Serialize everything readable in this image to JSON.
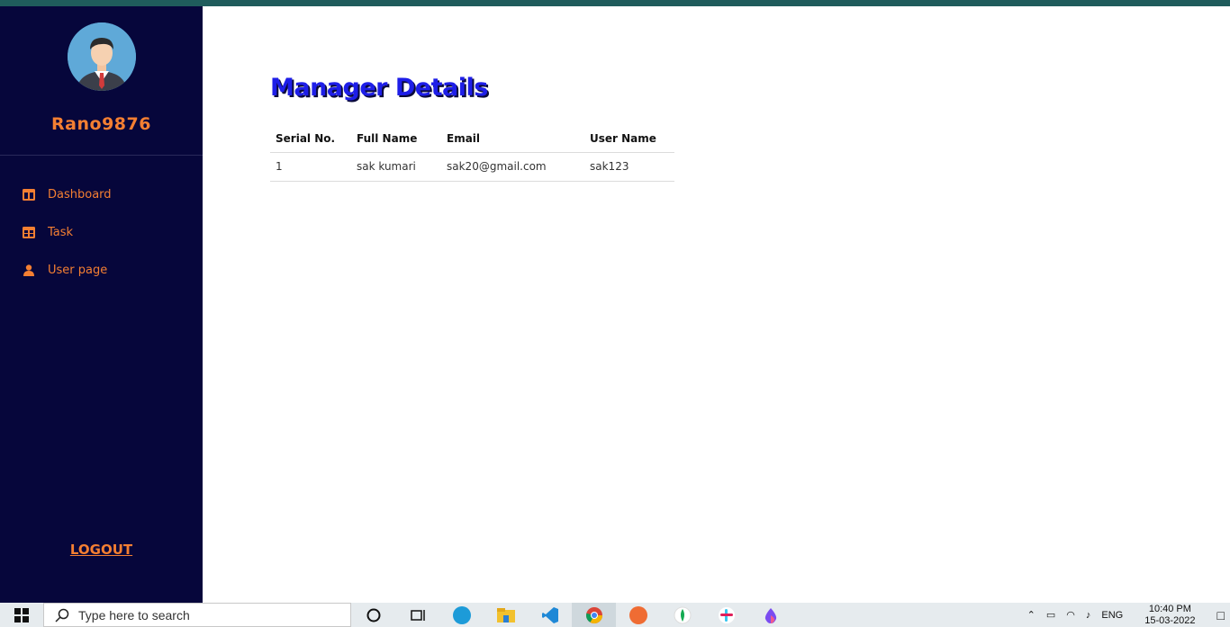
{
  "sidebar": {
    "username": "Rano9876",
    "nav": [
      {
        "label": "Dashboard",
        "icon": "columns-icon"
      },
      {
        "label": "Task",
        "icon": "table-icon"
      },
      {
        "label": "User page",
        "icon": "user-icon"
      }
    ],
    "logout_label": "LOGOUT"
  },
  "main": {
    "title": "Manager Details",
    "table": {
      "headers": [
        "Serial No.",
        "Full Name",
        "Email",
        "User Name"
      ],
      "rows": [
        [
          "1",
          "sak kumari",
          "sak20@gmail.com",
          "sak123"
        ]
      ]
    }
  },
  "taskbar": {
    "search_placeholder": "Type here to search",
    "language": "ENG",
    "time": "10:40 PM",
    "date": "15-03-2022"
  },
  "colors": {
    "sidebar_bg": "#06063b",
    "accent": "#f47f32",
    "title": "#1e1ee8"
  }
}
